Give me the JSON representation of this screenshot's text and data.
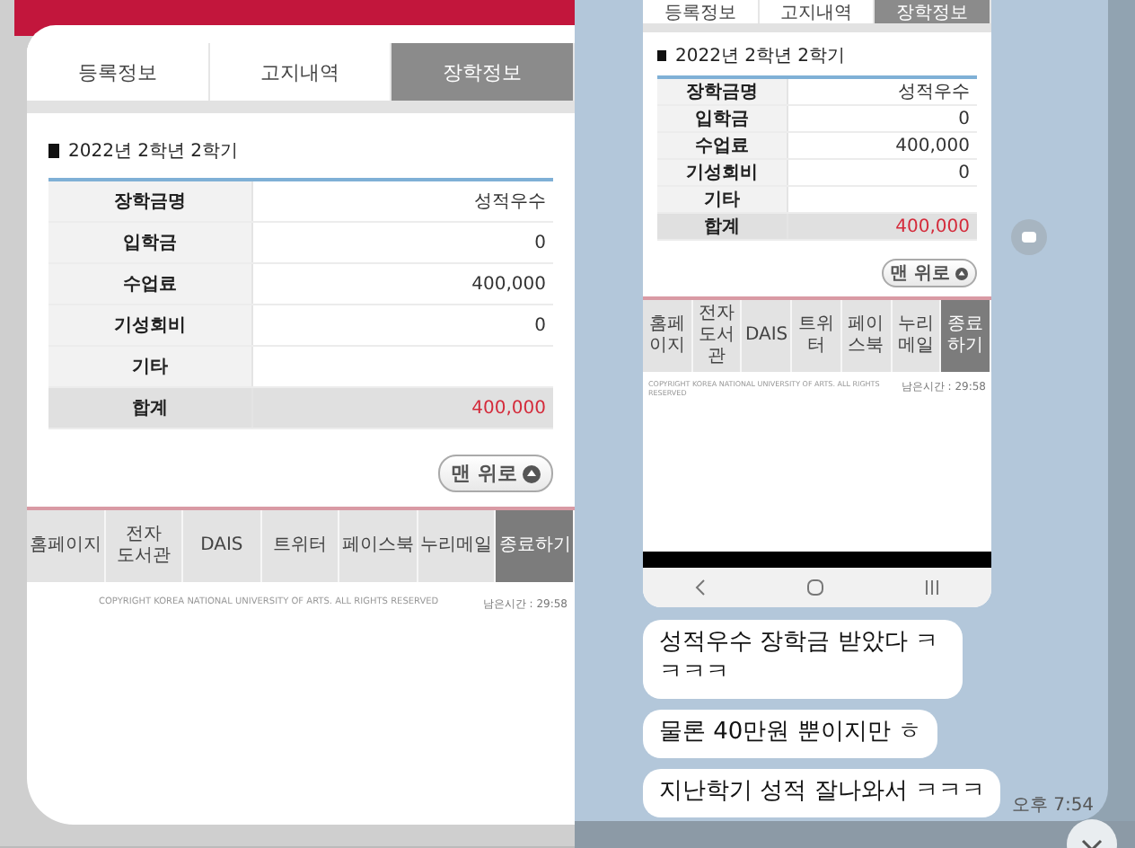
{
  "left_page": {
    "tabs": [
      {
        "label": "등록정보",
        "selected": false
      },
      {
        "label": "고지내역",
        "selected": false
      },
      {
        "label": "장학정보",
        "selected": true
      }
    ],
    "section_title": "2022년 2학년 2학기",
    "table": [
      {
        "label": "장학금명",
        "value": "성적우수",
        "kind": "normal"
      },
      {
        "label": "입학금",
        "value": "0",
        "kind": "normal"
      },
      {
        "label": "수업료",
        "value": "400,000",
        "kind": "normal"
      },
      {
        "label": "기성회비",
        "value": "0",
        "kind": "normal"
      },
      {
        "label": "기타",
        "kind": "normal"
      },
      {
        "label": "합계",
        "value": "400,000",
        "kind": "total"
      }
    ],
    "top_button": "맨 위로",
    "footer_menu": [
      {
        "label": "홈페이지",
        "selected": false
      },
      {
        "label": "전자 도서관",
        "selected": false
      },
      {
        "label": "DAIS",
        "selected": false
      },
      {
        "label": "트위터",
        "selected": false
      },
      {
        "label": "페이스북",
        "selected": false
      },
      {
        "label": "누리메일",
        "selected": false
      },
      {
        "label": "종료하기",
        "selected": true
      }
    ],
    "copyright": "COPYRIGHT KOREA NATIONAL UNIVERSITY OF ARTS. ALL RIGHTS RESERVED",
    "session_time": "남은시간 : 29:58"
  },
  "chat": {
    "screenshot": {
      "tabs": [
        {
          "label": "등록정보",
          "selected": false
        },
        {
          "label": "고지내역",
          "selected": false
        },
        {
          "label": "장학정보",
          "selected": true
        }
      ],
      "section_title": "2022년 2학년 2학기",
      "table": [
        {
          "label": "장학금명",
          "value": "성적우수",
          "kind": "normal"
        },
        {
          "label": "입학금",
          "value": "0",
          "kind": "normal"
        },
        {
          "label": "수업료",
          "value": "400,000",
          "kind": "normal"
        },
        {
          "label": "기성회비",
          "value": "0",
          "kind": "normal"
        },
        {
          "label": "기타",
          "kind": "normal"
        },
        {
          "label": "합계",
          "value": "400,000",
          "kind": "total"
        }
      ],
      "top_button": "맨 위로",
      "footer_menu": [
        {
          "label": "홈페이지",
          "selected": false
        },
        {
          "label": "전자 도서관",
          "selected": false
        },
        {
          "label": "DAIS",
          "selected": false
        },
        {
          "label": "트위터",
          "selected": false
        },
        {
          "label": "페이스북",
          "selected": false
        },
        {
          "label": "누리메일",
          "selected": false
        },
        {
          "label": "종료하기",
          "selected": true
        }
      ],
      "copyright": "COPYRIGHT KOREA NATIONAL UNIVERSITY OF ARTS. ALL RIGHTS RESERVED",
      "session_time": "남은시간 : 29:58"
    },
    "messages": [
      "성적우수 장학금 받았다 ㅋㅋㅋㅋ",
      "물론 40만원 뿐이지만 ㅎ",
      "지난학기 성적 잘나와서 ㅋㅋㅋ"
    ],
    "time": "오후 7:54"
  }
}
